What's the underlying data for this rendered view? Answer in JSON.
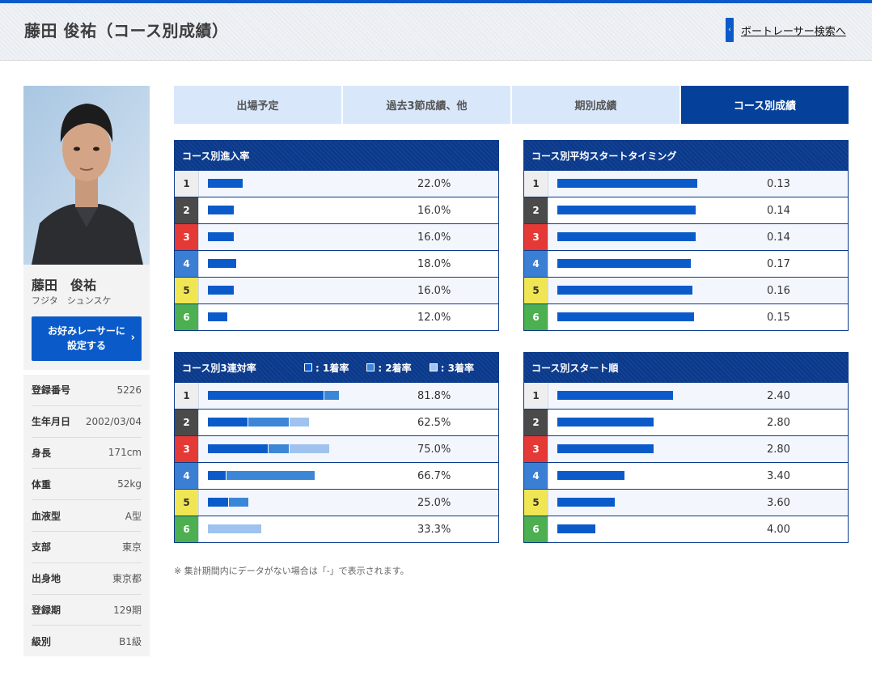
{
  "header": {
    "title": "藤田 俊祐（コース別成績）",
    "back_link": "ボートレーサー検索へ"
  },
  "profile": {
    "name_kanji": "藤田　俊祐",
    "name_kana": "フジタ　シュンスケ",
    "fav_button_line1": "お好みレーサーに",
    "fav_button_line2": "設定する",
    "info": [
      {
        "label": "登録番号",
        "value": "5226"
      },
      {
        "label": "生年月日",
        "value": "2002/03/04"
      },
      {
        "label": "身長",
        "value": "171cm"
      },
      {
        "label": "体重",
        "value": "52kg"
      },
      {
        "label": "血液型",
        "value": "A型"
      },
      {
        "label": "支部",
        "value": "東京"
      },
      {
        "label": "出身地",
        "value": "東京都"
      },
      {
        "label": "登録期",
        "value": "129期"
      },
      {
        "label": "級別",
        "value": "B1級"
      }
    ]
  },
  "tabs": [
    {
      "label": "出場予定",
      "active": false
    },
    {
      "label": "過去3節成績、他",
      "active": false
    },
    {
      "label": "期別成績",
      "active": false
    },
    {
      "label": "コース別成績",
      "active": true
    }
  ],
  "lanes": [
    "1",
    "2",
    "3",
    "4",
    "5",
    "6"
  ],
  "lane_colors": {
    "bg": [
      "#eeeeee",
      "#4a4a4a",
      "#e53935",
      "#3b7fd4",
      "#f0e553",
      "#4caf50"
    ],
    "fg": [
      "#333333",
      "#ffffff",
      "#ffffff",
      "#ffffff",
      "#333333",
      "#ffffff"
    ]
  },
  "colors": {
    "bar_primary": "#0a5bc9",
    "bar_second": "#3b86d6",
    "bar_third": "#9fc3ee",
    "header_bg": "#0b3a8c",
    "tab_active": "#05419b"
  },
  "tables": {
    "entry_rate": {
      "title": "コース別進入率",
      "rows": [
        {
          "value": "22.0%",
          "pct": 22.0
        },
        {
          "value": "16.0%",
          "pct": 16.0
        },
        {
          "value": "16.0%",
          "pct": 16.0
        },
        {
          "value": "18.0%",
          "pct": 18.0
        },
        {
          "value": "16.0%",
          "pct": 16.0
        },
        {
          "value": "12.0%",
          "pct": 12.0
        }
      ]
    },
    "start_timing": {
      "title": "コース別平均スタートタイミング",
      "rows": [
        {
          "value": "0.13"
        },
        {
          "value": "0.14"
        },
        {
          "value": "0.14"
        },
        {
          "value": "0.17"
        },
        {
          "value": "0.16"
        },
        {
          "value": "0.15"
        }
      ]
    },
    "top3_rate": {
      "title": "コース別3連対率",
      "legend": [
        ": 1着率",
        ": 2着率",
        ": 3着率"
      ],
      "rows": [
        {
          "value": "81.8%",
          "first": 72.7,
          "second": 9.1,
          "third": 0
        },
        {
          "value": "62.5%",
          "first": 25.0,
          "second": 25.0,
          "third": 12.5
        },
        {
          "value": "75.0%",
          "first": 37.5,
          "second": 12.5,
          "third": 25.0
        },
        {
          "value": "66.7%",
          "first": 11.1,
          "second": 55.6,
          "third": 0
        },
        {
          "value": "25.0%",
          "first": 12.5,
          "second": 12.5,
          "third": 0
        },
        {
          "value": "33.3%",
          "first": 0,
          "second": 0,
          "third": 33.3
        }
      ]
    },
    "start_order": {
      "title": "コース別スタート順",
      "rows": [
        {
          "value": "2.40"
        },
        {
          "value": "2.80"
        },
        {
          "value": "2.80"
        },
        {
          "value": "3.40"
        },
        {
          "value": "3.60"
        },
        {
          "value": "4.00"
        }
      ]
    }
  },
  "note": "※ 集計期間内にデータがない場合は「-」で表示されます。"
}
